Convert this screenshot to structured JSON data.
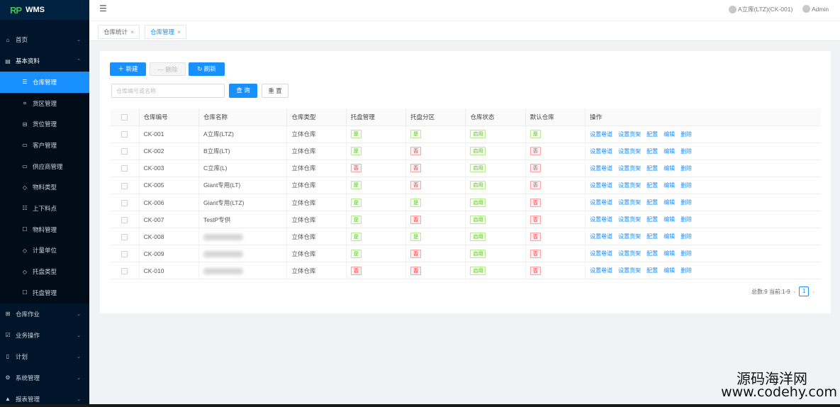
{
  "app": {
    "logo_mark": "RP",
    "logo_text": "WMS"
  },
  "header": {
    "warehouse": "A立库(LTZ)(CK-001)",
    "user": "Admin"
  },
  "tabs": [
    {
      "label": "仓库统计"
    },
    {
      "label": "仓库管理"
    }
  ],
  "sidebar": {
    "home": "首页",
    "basic": "基本资料",
    "sub": [
      {
        "label": "仓库管理",
        "icon": "☰"
      },
      {
        "label": "货区管理",
        "icon": "⌗"
      },
      {
        "label": "货位管理",
        "icon": "⊟"
      },
      {
        "label": "客户管理",
        "icon": "▭"
      },
      {
        "label": "供应商管理",
        "icon": "▭"
      },
      {
        "label": "物料类型",
        "icon": "◇"
      },
      {
        "label": "上下料点",
        "icon": "☷"
      },
      {
        "label": "物料管理",
        "icon": "☐"
      },
      {
        "label": "计量单位",
        "icon": "◇"
      },
      {
        "label": "托盘类型",
        "icon": "◇"
      },
      {
        "label": "托盘管理",
        "icon": "☐"
      }
    ],
    "groups": [
      {
        "label": "仓库作业",
        "icon": "⊞"
      },
      {
        "label": "业务操作",
        "icon": "☑"
      },
      {
        "label": "计划",
        "icon": "▯"
      },
      {
        "label": "系统管理",
        "icon": "⚙"
      },
      {
        "label": "报表管理",
        "icon": "▲"
      }
    ]
  },
  "toolbar": {
    "new": "新建",
    "delete": "删除",
    "refresh": "刷新",
    "search_placeholder": "仓库编号或名称",
    "query": "查 询",
    "reset": "重 置"
  },
  "table": {
    "headers": [
      "仓库编号",
      "仓库名称",
      "仓库类型",
      "托盘管理",
      "托盘分区",
      "仓库状态",
      "默认仓库",
      "操作"
    ],
    "ops": [
      "设置巷道",
      "设置货架",
      "配置",
      "编辑",
      "删除"
    ],
    "rows": [
      {
        "code": "CK-001",
        "name": "A立库(LTZ)",
        "type": "立体仓库",
        "pallet": "是",
        "zone": "是",
        "status": "启用",
        "default": "是"
      },
      {
        "code": "CK-002",
        "name": "B立库(LT)",
        "type": "立体仓库",
        "pallet": "是",
        "zone": "否",
        "status": "启用",
        "default": "否"
      },
      {
        "code": "CK-003",
        "name": "C立库(L)",
        "type": "立体仓库",
        "pallet": "否",
        "zone": "否",
        "status": "启用",
        "default": "否"
      },
      {
        "code": "CK-005",
        "name": "Giant专用(LT)",
        "type": "立体仓库",
        "pallet": "是",
        "zone": "否",
        "status": "启用",
        "default": "否"
      },
      {
        "code": "CK-006",
        "name": "Giant专用(LTZ)",
        "type": "立体仓库",
        "pallet": "是",
        "zone": "是",
        "status": "启用",
        "default": "否"
      },
      {
        "code": "CK-007",
        "name": "TestP专供",
        "type": "立体仓库",
        "pallet": "是",
        "zone": "否",
        "status": "启用",
        "default": "否"
      },
      {
        "code": "CK-008",
        "name": "",
        "type": "立体仓库",
        "pallet": "是",
        "zone": "是",
        "status": "启用",
        "default": "否"
      },
      {
        "code": "CK-009",
        "name": "",
        "type": "立体仓库",
        "pallet": "是",
        "zone": "否",
        "status": "启用",
        "default": "否"
      },
      {
        "code": "CK-010",
        "name": "",
        "type": "立体仓库",
        "pallet": "否",
        "zone": "否",
        "status": "启用",
        "default": "否"
      }
    ]
  },
  "pager": {
    "summary": "总数:9 当前:1-9",
    "current": "1"
  },
  "watermark": {
    "line1": "源码海洋网",
    "line2": "www.codehy.com"
  }
}
